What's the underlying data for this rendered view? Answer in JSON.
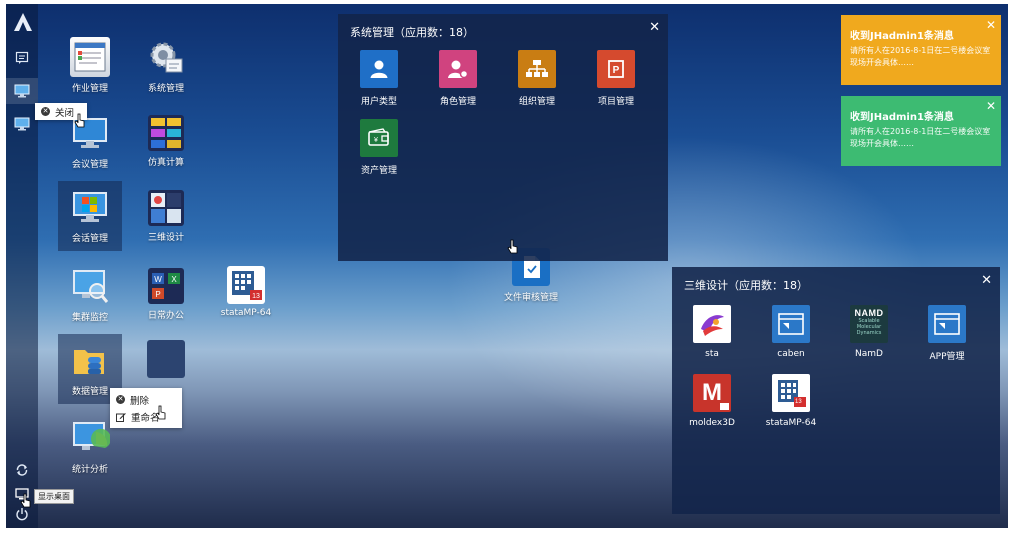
{
  "desktop_icons": [
    {
      "label": "作业管理",
      "icon": "job-management-icon"
    },
    {
      "label": "系统管理",
      "icon": "system-gear-icon"
    },
    {
      "label": "会议管理",
      "icon": "meeting-monitor-icon"
    },
    {
      "label": "仿真计算",
      "icon": "simulation-icon"
    },
    {
      "label": "会话管理",
      "icon": "session-windows-icon"
    },
    {
      "label": "三维设计",
      "icon": "3d-design-icon"
    },
    {
      "label": "集群监控",
      "icon": "cluster-monitor-icon"
    },
    {
      "label": "日常办公",
      "icon": "office-apps-icon"
    },
    {
      "label": "stataMP-64",
      "icon": "stata-icon"
    },
    {
      "label": "数据管理",
      "icon": "data-folder-icon"
    },
    {
      "label": "",
      "icon": "folder-tile-icon"
    },
    {
      "label": "统计分析",
      "icon": "statistics-chart-icon"
    },
    {
      "label": "文件审核管理",
      "icon": "file-review-icon"
    }
  ],
  "taskbar": {
    "tooltip": "显示桌面"
  },
  "context_menu_taskbar": {
    "close_label": "关闭"
  },
  "context_menu_icon": {
    "delete_label": "删除",
    "rename_label": "重命名"
  },
  "window_system": {
    "title": "系统管理（应用数：18）",
    "close": "✕",
    "apps": [
      {
        "label": "用户类型",
        "icon": "user-type-icon",
        "color": "#1f6fc7"
      },
      {
        "label": "角色管理",
        "icon": "role-management-icon",
        "color": "#d0437f"
      },
      {
        "label": "组织管理",
        "icon": "organization-icon",
        "color": "#c97d13"
      },
      {
        "label": "项目管理",
        "icon": "project-icon",
        "color": "#d54a2e"
      },
      {
        "label": "资产管理",
        "icon": "asset-wallet-icon",
        "color": "#1e7a3e"
      }
    ]
  },
  "window_3d": {
    "title": "三维设计（应用数：18）",
    "close": "✕",
    "apps": [
      {
        "label": "sta",
        "icon": "sta-icon"
      },
      {
        "label": "caben",
        "icon": "caben-window-icon"
      },
      {
        "label": "NamD",
        "icon": "namd-icon",
        "logo_text": "NAMD",
        "logo_sub": "Scalable Molecular Dynamics"
      },
      {
        "label": "APP管理",
        "icon": "app-window-icon"
      },
      {
        "label": "moldex3D",
        "icon": "moldex-icon",
        "logo_text": "M"
      },
      {
        "label": "stataMP-64",
        "icon": "stata-icon",
        "badge": "13"
      }
    ]
  },
  "notifications": [
    {
      "title": "收到JHadmin1条消息",
      "body": "请所有人在2016-8-1日在二号楼会议室现场开会具体……",
      "color": "#f0a91e"
    },
    {
      "title": "收到JHadmin1条消息",
      "body": "请所有人在2016-8-1日在二号楼会议室现场开会具体……",
      "color": "#3dbb72"
    }
  ]
}
